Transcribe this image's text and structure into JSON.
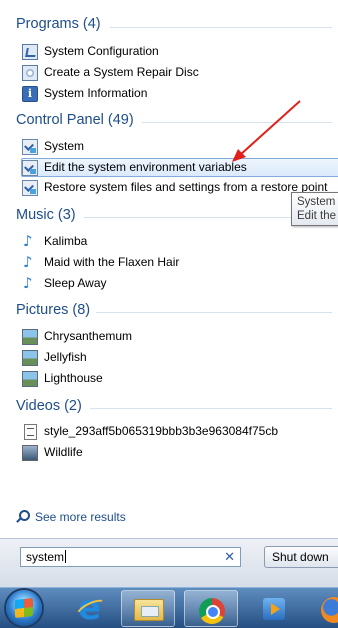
{
  "groups": [
    {
      "title": "Programs (4)",
      "items": [
        {
          "label": "System Configuration",
          "icon": "system-configuration-icon"
        },
        {
          "label": "Create a System Repair Disc",
          "icon": "repair-disc-icon"
        },
        {
          "label": "System Information",
          "icon": "system-information-icon"
        }
      ]
    },
    {
      "title": "Control Panel (49)",
      "items": [
        {
          "label": "System",
          "icon": "control-panel-icon"
        },
        {
          "label": "Edit the system environment variables",
          "icon": "control-panel-icon",
          "selected": true
        },
        {
          "label": "Restore system files and settings from a restore point",
          "icon": "control-panel-icon"
        }
      ]
    },
    {
      "title": "Music (3)",
      "items": [
        {
          "label": "Kalimba",
          "icon": "music-file-icon"
        },
        {
          "label": "Maid with the Flaxen Hair",
          "icon": "music-file-icon"
        },
        {
          "label": "Sleep Away",
          "icon": "music-file-icon"
        }
      ]
    },
    {
      "title": "Pictures (8)",
      "items": [
        {
          "label": "Chrysanthemum",
          "icon": "picture-file-icon"
        },
        {
          "label": "Jellyfish",
          "icon": "picture-file-icon"
        },
        {
          "label": "Lighthouse",
          "icon": "picture-file-icon"
        }
      ]
    },
    {
      "title": "Videos (2)",
      "items": [
        {
          "label": "style_293aff5b065319bbb3b3e963084f75cb",
          "icon": "video-file-icon"
        },
        {
          "label": "Wildlife",
          "icon": "video-file-icon"
        }
      ]
    }
  ],
  "see_more": "See more results",
  "search": {
    "value": "system"
  },
  "shutdown_label": "Shut down",
  "tooltip": {
    "line1": "System",
    "line2": "Edit the"
  },
  "colors": {
    "group_title": "#1e4e8c",
    "annotation_arrow": "#e0201b",
    "selection_border": "#84acdd"
  }
}
